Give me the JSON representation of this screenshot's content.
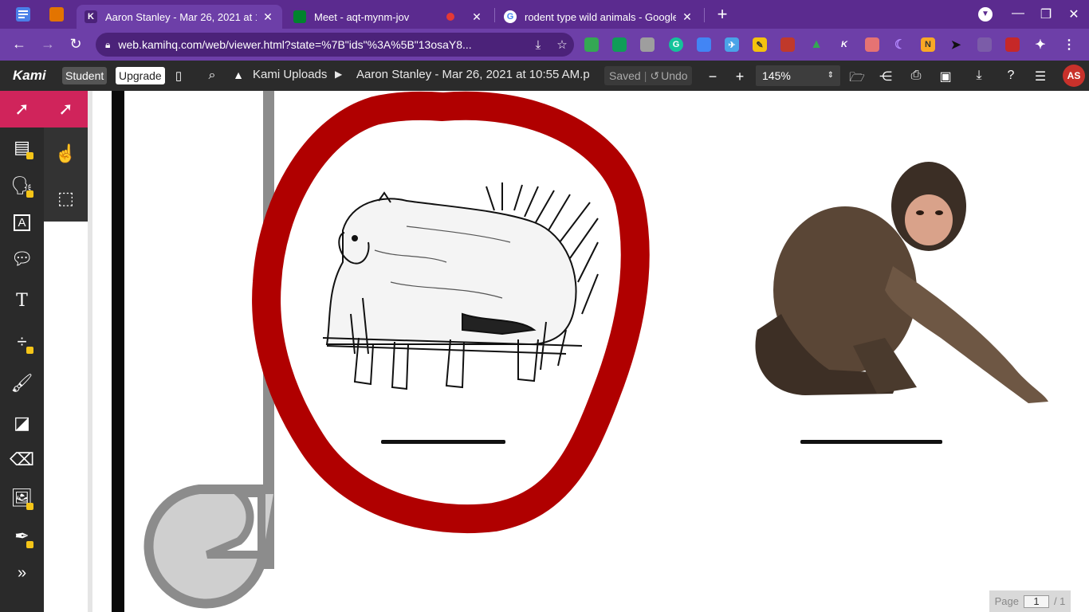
{
  "browser": {
    "tabs": [
      {
        "title": "Aaron Stanley - Mar 26, 2021 at 1",
        "active": true
      },
      {
        "title": "Meet - aqt-mynm-jov",
        "recording": true
      },
      {
        "title": "rodent type wild animals - Google",
        "active": false
      }
    ],
    "url": "web.kamihq.com/web/viewer.html?state=%7B\"ids\"%3A%5B\"13osaY8..."
  },
  "kami": {
    "logo": "Kami",
    "student_label": "Student",
    "upgrade_label": "Upgrade",
    "breadcrumb_folder": "Kami Uploads",
    "document_title": "Aaron Stanley - Mar 26, 2021 at 10:55 AM.p",
    "saved_label": "Saved",
    "undo_label": "Undo",
    "zoom": "145%",
    "avatar_initials": "AS"
  },
  "page_indicator": {
    "label": "Page",
    "current": "1",
    "total": "/ 1"
  },
  "colors": {
    "tabstrip": "#5b2b8f",
    "toolbar": "#6d3fa8",
    "kami_header": "#2b2b2b",
    "tool_selected": "#d0245b",
    "annotation_red": "#b00000"
  }
}
